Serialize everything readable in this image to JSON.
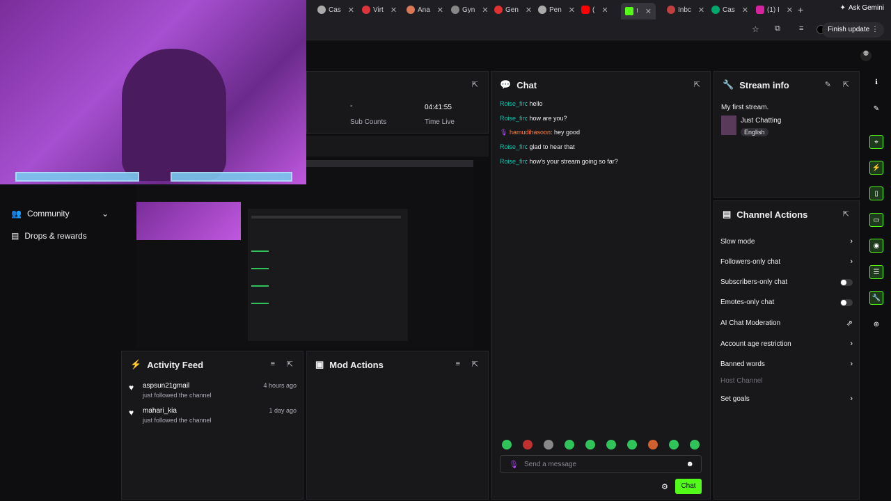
{
  "browser": {
    "tabs": [
      {
        "label": "Cas",
        "color": "#aaaaaa"
      },
      {
        "label": "Virt",
        "color": "#e0343c"
      },
      {
        "label": "Ana",
        "color": "#d97757"
      },
      {
        "label": "Gyn",
        "color": "#888888"
      },
      {
        "label": "Gen",
        "color": "#e03030"
      },
      {
        "label": "Pen",
        "color": "#aaaaaa"
      },
      {
        "label": "(",
        "color": "#ff0000"
      },
      {
        "label": "!",
        "color": "#53fc18"
      },
      {
        "label": "Inbc",
        "color": "#c04040"
      },
      {
        "label": "Cas",
        "color": "#00a86b"
      },
      {
        "label": "(1) I",
        "color": "#d6249f"
      }
    ],
    "ask_gemini": "Ask Gemini",
    "finish_update": "Finish update"
  },
  "left_nav": {
    "community": "Community",
    "drops": "Drops & rewards"
  },
  "stats": {
    "sub_counts_value": "-",
    "sub_counts_label": "Sub Counts",
    "time_live_value": "04:41:55",
    "time_live_label": "Time Live"
  },
  "chat": {
    "title": "Chat",
    "messages": [
      {
        "user": "Roise_fin",
        "text": ": hello"
      },
      {
        "user": "Roise_fin",
        "text": ": how are you?"
      },
      {
        "user": "hamudihasoon",
        "text": ": hey good"
      },
      {
        "user": "Roise_fin",
        "text": ": glad to hear that"
      },
      {
        "user": "Roise_fin",
        "text": ": how's your stream going so far?"
      }
    ],
    "placeholder": "Send a message",
    "send_label": "Chat"
  },
  "stream_info": {
    "title": "Stream info",
    "stream_title": "My first stream.",
    "category": "Just Chatting",
    "language": "English"
  },
  "channel_actions": {
    "title": "Channel Actions",
    "items": [
      {
        "label": "Slow mode",
        "control": "chevron"
      },
      {
        "label": "Followers-only chat",
        "control": "chevron"
      },
      {
        "label": "Subscribers-only chat",
        "control": "toggle"
      },
      {
        "label": "Emotes-only chat",
        "control": "toggle"
      },
      {
        "label": "AI Chat Moderation",
        "control": "external"
      },
      {
        "label": "Account age restriction",
        "control": "chevron"
      },
      {
        "label": "Banned words",
        "control": "chevron"
      },
      {
        "label": "Host Channel",
        "control": "none"
      },
      {
        "label": "Set goals",
        "control": "chevron"
      }
    ]
  },
  "activity_feed": {
    "title": "Activity Feed",
    "items": [
      {
        "user": "aspsun21gmail",
        "time": "4 hours ago",
        "text": "just followed the channel"
      },
      {
        "user": "mahari_kia",
        "time": "1 day ago",
        "text": "just followed the channel"
      }
    ]
  },
  "mod_actions": {
    "title": "Mod Actions"
  }
}
